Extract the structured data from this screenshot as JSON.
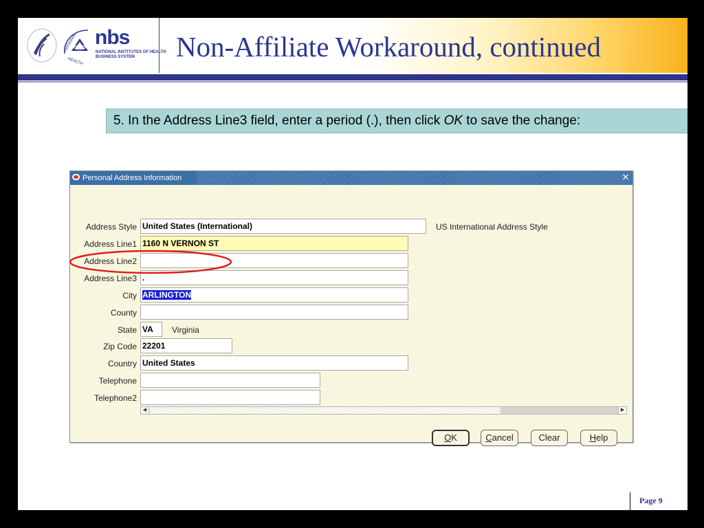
{
  "header": {
    "logo_word": "nbs",
    "logo_sub1": "NATIONAL INSTITUTES OF HEALTH",
    "logo_sub2": "BUSINESS SYSTEM",
    "title": "Non-Affiliate Workaround, continued"
  },
  "instruction": {
    "pre": "5.  In the Address Line3 field, enter a period (.), then click ",
    "emph": "OK",
    "post": " to save the change:"
  },
  "dialog": {
    "title": "Personal Address Information",
    "fields": {
      "address_style": {
        "label": "Address Style",
        "value": "United States (International)",
        "desc": "US International Address Style"
      },
      "address_line1": {
        "label": "Address Line1",
        "value": "1160 N VERNON ST"
      },
      "address_line2": {
        "label": "Address Line2",
        "value": ""
      },
      "address_line3": {
        "label": "Address Line3",
        "value": "."
      },
      "city": {
        "label": "City",
        "value": "ARLINGTON"
      },
      "county": {
        "label": "County",
        "value": ""
      },
      "state": {
        "label": "State",
        "value": "VA",
        "desc": "Virginia"
      },
      "zip_code": {
        "label": "Zip Code",
        "value": "22201"
      },
      "country": {
        "label": "Country",
        "value": "United States"
      },
      "telephone": {
        "label": "Telephone",
        "value": ""
      },
      "telephone2": {
        "label": "Telephone2",
        "value": ""
      }
    },
    "buttons": {
      "ok": {
        "mnemonic": "O",
        "rest": "K"
      },
      "cancel": {
        "mnemonic": "C",
        "rest": "ancel"
      },
      "clear": {
        "label": "Clear"
      },
      "help": {
        "mnemonic": "H",
        "rest": "elp"
      }
    }
  },
  "footer": {
    "page": "Page 9"
  },
  "colors": {
    "accent_blue": "#2c3690",
    "header_gold": "#f9b21c",
    "instruction_bg": "#a9d6d5",
    "titlebar_blue": "#3c6fa6",
    "required_yellow": "#fffbb2",
    "annotation_red": "#e01b1b"
  }
}
